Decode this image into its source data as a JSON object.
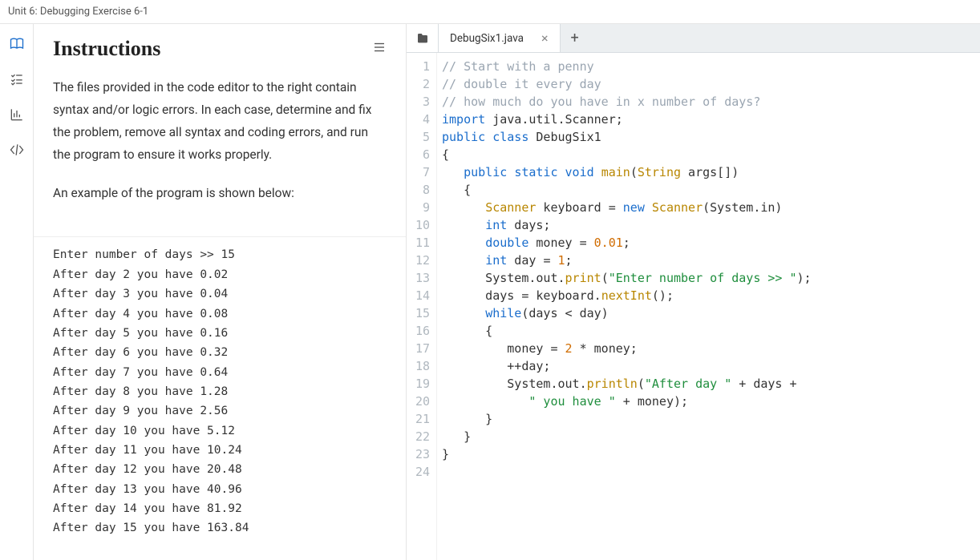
{
  "title": "Unit 6: Debugging Exercise 6-1",
  "sidebar": {
    "icons": [
      "book-icon",
      "checklist-icon",
      "chart-icon",
      "code-icon"
    ]
  },
  "instructions": {
    "heading": "Instructions",
    "para1": "The files provided in the code editor to the right contain syntax and/or logic errors. In each case, determine and fix the problem, remove all syntax and coding errors, and run the program to ensure it works properly.",
    "para2": "An example of the program is shown below:",
    "sample": "Enter number of days >> 15\nAfter day 2 you have 0.02\nAfter day 3 you have 0.04\nAfter day 4 you have 0.08\nAfter day 5 you have 0.16\nAfter day 6 you have 0.32\nAfter day 7 you have 0.64\nAfter day 8 you have 1.28\nAfter day 9 you have 2.56\nAfter day 10 you have 5.12\nAfter day 11 you have 10.24\nAfter day 12 you have 20.48\nAfter day 13 you have 40.96\nAfter day 14 you have 81.92\nAfter day 15 you have 163.84"
  },
  "editor": {
    "tab": "DebugSix1.java",
    "lineCount": 24,
    "code": [
      [
        {
          "t": "// Start with a penny",
          "c": "c-comment"
        }
      ],
      [
        {
          "t": "// double it every day",
          "c": "c-comment"
        }
      ],
      [
        {
          "t": "// how much do you have in x number of days?",
          "c": "c-comment"
        }
      ],
      [
        {
          "t": "import",
          "c": "c-keyword"
        },
        {
          "t": " java.util.Scanner;",
          "c": "c-ident"
        }
      ],
      [
        {
          "t": "public",
          "c": "c-keyword"
        },
        {
          "t": " ",
          "c": ""
        },
        {
          "t": "class",
          "c": "c-keyword"
        },
        {
          "t": " DebugSix1",
          "c": "c-class"
        }
      ],
      [
        {
          "t": "{",
          "c": "c-punc"
        }
      ],
      [
        {
          "t": "   ",
          "c": ""
        },
        {
          "t": "public",
          "c": "c-keyword"
        },
        {
          "t": " ",
          "c": ""
        },
        {
          "t": "static",
          "c": "c-keyword"
        },
        {
          "t": " ",
          "c": ""
        },
        {
          "t": "void",
          "c": "c-keyword"
        },
        {
          "t": " ",
          "c": ""
        },
        {
          "t": "main",
          "c": "c-funcdef"
        },
        {
          "t": "(",
          "c": "c-punc"
        },
        {
          "t": "String",
          "c": "c-typename"
        },
        {
          "t": " args[])",
          "c": "c-ident"
        }
      ],
      [
        {
          "t": "   {",
          "c": "c-punc"
        }
      ],
      [
        {
          "t": "      ",
          "c": ""
        },
        {
          "t": "Scanner",
          "c": "c-typename"
        },
        {
          "t": " keyboard ",
          "c": "c-ident"
        },
        {
          "t": "=",
          "c": "c-punc"
        },
        {
          "t": " ",
          "c": ""
        },
        {
          "t": "new",
          "c": "c-new"
        },
        {
          "t": " ",
          "c": ""
        },
        {
          "t": "Scanner",
          "c": "c-typename"
        },
        {
          "t": "(System.in)",
          "c": "c-ident"
        }
      ],
      [
        {
          "t": "      ",
          "c": ""
        },
        {
          "t": "int",
          "c": "c-keyword"
        },
        {
          "t": " days;",
          "c": "c-ident"
        }
      ],
      [
        {
          "t": "      ",
          "c": ""
        },
        {
          "t": "double",
          "c": "c-keyword"
        },
        {
          "t": " money ",
          "c": "c-ident"
        },
        {
          "t": "=",
          "c": "c-punc"
        },
        {
          "t": " ",
          "c": ""
        },
        {
          "t": "0.01",
          "c": "c-number"
        },
        {
          "t": ";",
          "c": "c-punc"
        }
      ],
      [
        {
          "t": "      ",
          "c": ""
        },
        {
          "t": "int",
          "c": "c-keyword"
        },
        {
          "t": " day ",
          "c": "c-ident"
        },
        {
          "t": "=",
          "c": "c-punc"
        },
        {
          "t": " ",
          "c": ""
        },
        {
          "t": "1",
          "c": "c-number"
        },
        {
          "t": ";",
          "c": "c-punc"
        }
      ],
      [
        {
          "t": "      System.out.",
          "c": "c-ident"
        },
        {
          "t": "print",
          "c": "c-method"
        },
        {
          "t": "(",
          "c": "c-punc"
        },
        {
          "t": "\"Enter number of days >> \"",
          "c": "c-string"
        },
        {
          "t": ");",
          "c": "c-punc"
        }
      ],
      [
        {
          "t": "      days ",
          "c": "c-ident"
        },
        {
          "t": "=",
          "c": "c-punc"
        },
        {
          "t": " keyboard.",
          "c": "c-ident"
        },
        {
          "t": "nextInt",
          "c": "c-method"
        },
        {
          "t": "();",
          "c": "c-punc"
        }
      ],
      [
        {
          "t": "      ",
          "c": ""
        },
        {
          "t": "while",
          "c": "c-keyword"
        },
        {
          "t": "(days ",
          "c": "c-ident"
        },
        {
          "t": "<",
          "c": "c-punc"
        },
        {
          "t": " day)",
          "c": "c-ident"
        }
      ],
      [
        {
          "t": "      {",
          "c": "c-punc"
        }
      ],
      [
        {
          "t": "         money ",
          "c": "c-ident"
        },
        {
          "t": "=",
          "c": "c-punc"
        },
        {
          "t": " ",
          "c": ""
        },
        {
          "t": "2",
          "c": "c-number"
        },
        {
          "t": " ",
          "c": ""
        },
        {
          "t": "*",
          "c": "c-punc"
        },
        {
          "t": " money;",
          "c": "c-ident"
        }
      ],
      [
        {
          "t": "         ",
          "c": ""
        },
        {
          "t": "++",
          "c": "c-punc"
        },
        {
          "t": "day;",
          "c": "c-ident"
        }
      ],
      [
        {
          "t": "         System.out.",
          "c": "c-ident"
        },
        {
          "t": "println",
          "c": "c-method"
        },
        {
          "t": "(",
          "c": "c-punc"
        },
        {
          "t": "\"After day \"",
          "c": "c-string"
        },
        {
          "t": " ",
          "c": ""
        },
        {
          "t": "+",
          "c": "c-punc"
        },
        {
          "t": " days ",
          "c": "c-ident"
        },
        {
          "t": "+",
          "c": "c-punc"
        }
      ],
      [
        {
          "t": "            ",
          "c": ""
        },
        {
          "t": "\" you have \"",
          "c": "c-string"
        },
        {
          "t": " ",
          "c": ""
        },
        {
          "t": "+",
          "c": "c-punc"
        },
        {
          "t": " money);",
          "c": "c-ident"
        }
      ],
      [
        {
          "t": "      }",
          "c": "c-punc"
        }
      ],
      [
        {
          "t": "   }",
          "c": "c-punc"
        }
      ],
      [
        {
          "t": "}",
          "c": "c-punc"
        }
      ],
      [
        {
          "t": "",
          "c": ""
        }
      ]
    ]
  }
}
